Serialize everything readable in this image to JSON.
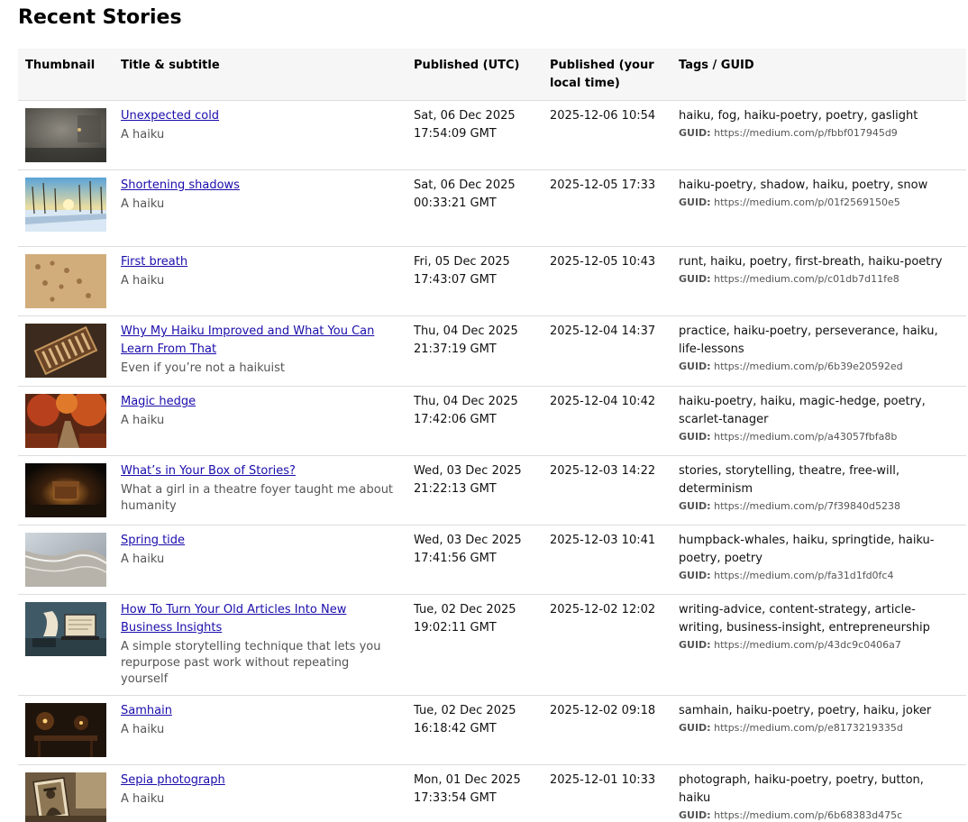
{
  "page": {
    "title": "Recent Stories"
  },
  "table": {
    "headers": {
      "thumbnail": "Thumbnail",
      "title": "Title & subtitle",
      "published_utc": "Published (UTC)",
      "published_local": "Published (your local time)",
      "tags": "Tags / GUID"
    },
    "guid_label": "GUID:",
    "rows": [
      {
        "title": "Unexpected cold",
        "subtitle": "A haiku",
        "utc": "Sat, 06 Dec 2025 17:54:09 GMT",
        "local": "2025-12-06 10:54",
        "tags": "haiku, fog, haiku-poetry, poetry, gaslight",
        "guid": "https://medium.com/p/fbbf017945d9"
      },
      {
        "title": "Shortening shadows",
        "subtitle": "A haiku",
        "utc": "Sat, 06 Dec 2025 00:33:21 GMT",
        "local": "2025-12-05 17:33",
        "tags": "haiku-poetry, shadow, haiku, poetry, snow",
        "guid": "https://medium.com/p/01f2569150e5"
      },
      {
        "title": "First breath",
        "subtitle": "A haiku",
        "utc": "Fri, 05 Dec 2025 17:43:07 GMT",
        "local": "2025-12-05 10:43",
        "tags": "runt, haiku, poetry, first-breath, haiku-poetry",
        "guid": "https://medium.com/p/c01db7d11fe8"
      },
      {
        "title": "Why My Haiku Improved and What You Can Learn From That",
        "subtitle": "Even if you’re not a haikuist",
        "utc": "Thu, 04 Dec 2025 21:37:19 GMT",
        "local": "2025-12-04 14:37",
        "tags": "practice, haiku-poetry, perseverance, haiku, life-lessons",
        "guid": "https://medium.com/p/6b39e20592ed"
      },
      {
        "title": "Magic hedge",
        "subtitle": "A haiku",
        "utc": "Thu, 04 Dec 2025 17:42:06 GMT",
        "local": "2025-12-04 10:42",
        "tags": "haiku-poetry, haiku, magic-hedge, poetry, scarlet-tanager",
        "guid": "https://medium.com/p/a43057fbfa8b"
      },
      {
        "title": "What’s in Your Box of Stories?",
        "subtitle": "What a girl in a theatre foyer taught me about humanity",
        "utc": "Wed, 03 Dec 2025 21:22:13 GMT",
        "local": "2025-12-03 14:22",
        "tags": "stories, storytelling, theatre, free-will, determinism",
        "guid": "https://medium.com/p/7f39840d5238"
      },
      {
        "title": "Spring tide",
        "subtitle": "A haiku",
        "utc": "Wed, 03 Dec 2025 17:41:56 GMT",
        "local": "2025-12-03 10:41",
        "tags": "humpback-whales, haiku, springtide, haiku-poetry, poetry",
        "guid": "https://medium.com/p/fa31d1fd0fc4"
      },
      {
        "title": "How To Turn Your Old Articles Into New Business Insights",
        "subtitle": "A simple storytelling technique that lets you repurpose past work without repeating yourself",
        "utc": "Tue, 02 Dec 2025 19:02:11 GMT",
        "local": "2025-12-02 12:02",
        "tags": "writing-advice, content-strategy, article-writing, business-insight, entrepreneurship",
        "guid": "https://medium.com/p/43dc9c0406a7"
      },
      {
        "title": "Samhain",
        "subtitle": "A haiku",
        "utc": "Tue, 02 Dec 2025 16:18:42 GMT",
        "local": "2025-12-02 09:18",
        "tags": "samhain, haiku-poetry, poetry, haiku, joker",
        "guid": "https://medium.com/p/e8173219335d"
      },
      {
        "title": "Sepia photograph",
        "subtitle": "A haiku",
        "utc": "Mon, 01 Dec 2025 17:33:54 GMT",
        "local": "2025-12-01 10:33",
        "tags": "photograph, haiku-poetry, poetry, button, haiku",
        "guid": "https://medium.com/p/6b68383d475c"
      }
    ]
  },
  "colors": {
    "link": "#1a0dab",
    "header_bg": "#f6f6f6",
    "border": "#dddddd",
    "muted": "#555555"
  }
}
